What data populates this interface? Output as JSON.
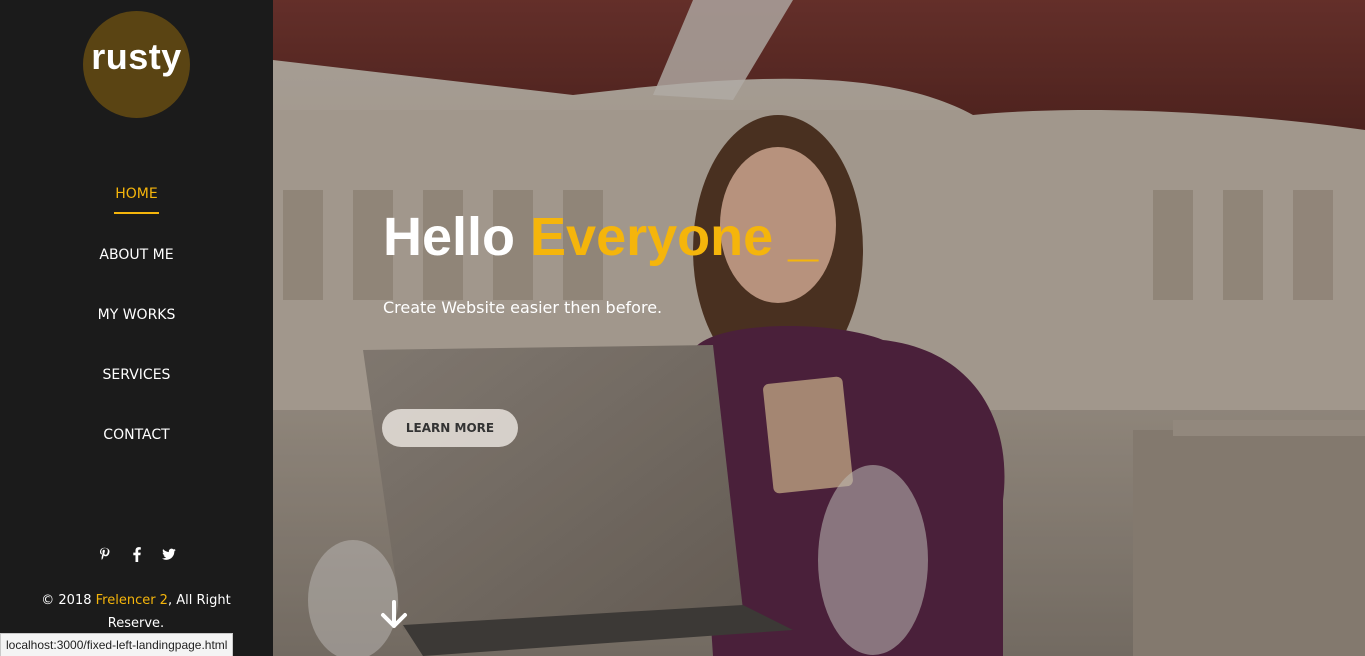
{
  "sidebar": {
    "logo": "rusty",
    "nav": [
      {
        "label": "HOME",
        "active": true
      },
      {
        "label": "ABOUT ME",
        "active": false
      },
      {
        "label": "MY WORKS",
        "active": false
      },
      {
        "label": "SERVICES",
        "active": false
      },
      {
        "label": "CONTACT",
        "active": false
      }
    ],
    "social_icons": [
      "pinterest-icon",
      "facebook-icon",
      "twitter-icon"
    ],
    "copyright": {
      "prefix": "© 2018 ",
      "brand": "Frelencer 2",
      "suffix": ", All Right Reserve."
    }
  },
  "hero": {
    "title_plain": "Hello ",
    "title_accent": "Everyone _",
    "subtitle": "Create Website easier then before.",
    "button_label": "LEARN MORE"
  },
  "status_bar": {
    "url": "localhost:3000/fixed-left-landingpage.html"
  },
  "colors": {
    "accent": "#f5b50b",
    "sidebar_bg": "#1b1b1b",
    "logo_circle": "#5a4413"
  }
}
